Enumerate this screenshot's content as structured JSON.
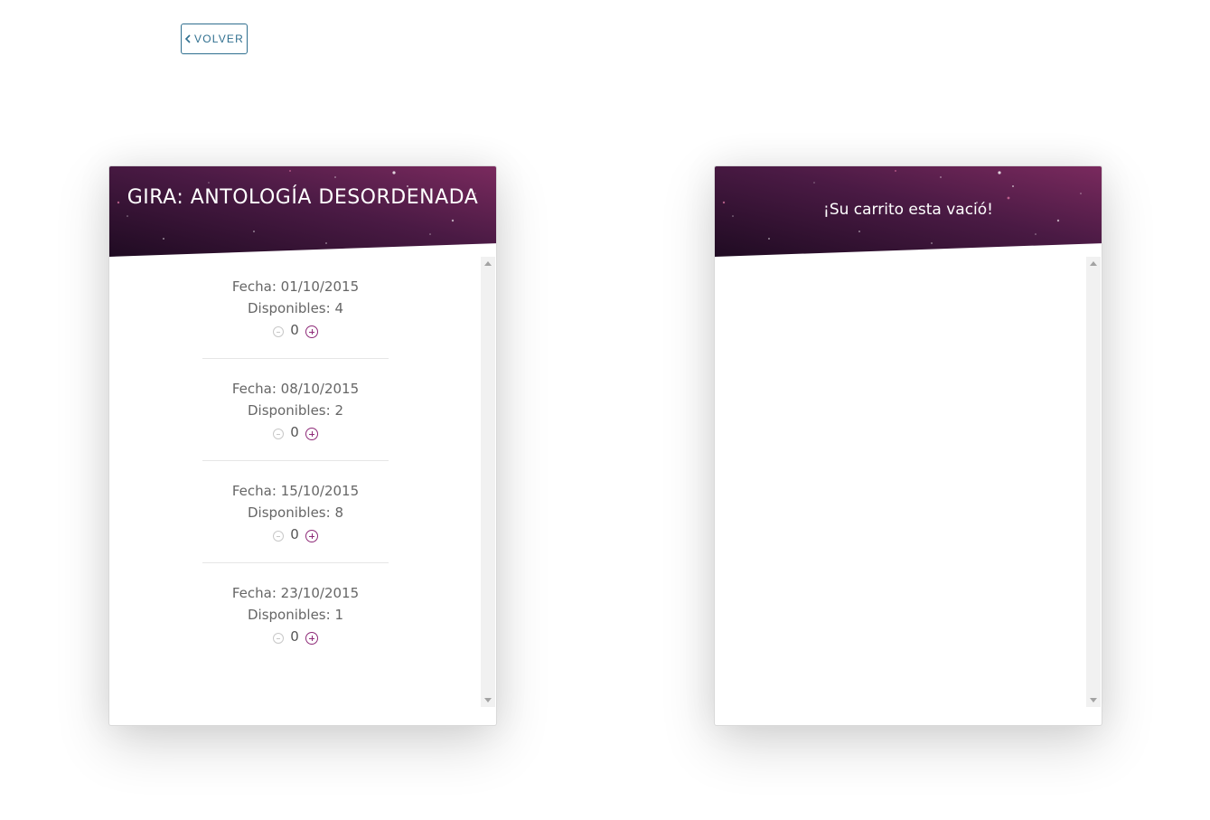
{
  "nav": {
    "back_label": "VOLVER"
  },
  "event_panel": {
    "title": "GIRA: ANTOLOGÍA DESORDENADA",
    "dates": [
      {
        "date_label": "Fecha: 01/10/2015",
        "available_label": "Disponibles: 4",
        "quantity": "0"
      },
      {
        "date_label": "Fecha: 08/10/2015",
        "available_label": "Disponibles: 2",
        "quantity": "0"
      },
      {
        "date_label": "Fecha: 15/10/2015",
        "available_label": "Disponibles: 8",
        "quantity": "0"
      },
      {
        "date_label": "Fecha: 23/10/2015",
        "available_label": "Disponibles: 1",
        "quantity": "0"
      }
    ]
  },
  "cart_panel": {
    "title": "¡Su carrito esta vació!"
  },
  "colors": {
    "header_dark": "#2a0f2b",
    "header_accent": "#7a2a5e",
    "plus_icon": "#8e2a78",
    "back_button": "#2f6f8f"
  },
  "icons": {
    "back": "chevron-left-icon",
    "decrement": "minus-circle-icon",
    "increment": "plus-circle-icon"
  }
}
